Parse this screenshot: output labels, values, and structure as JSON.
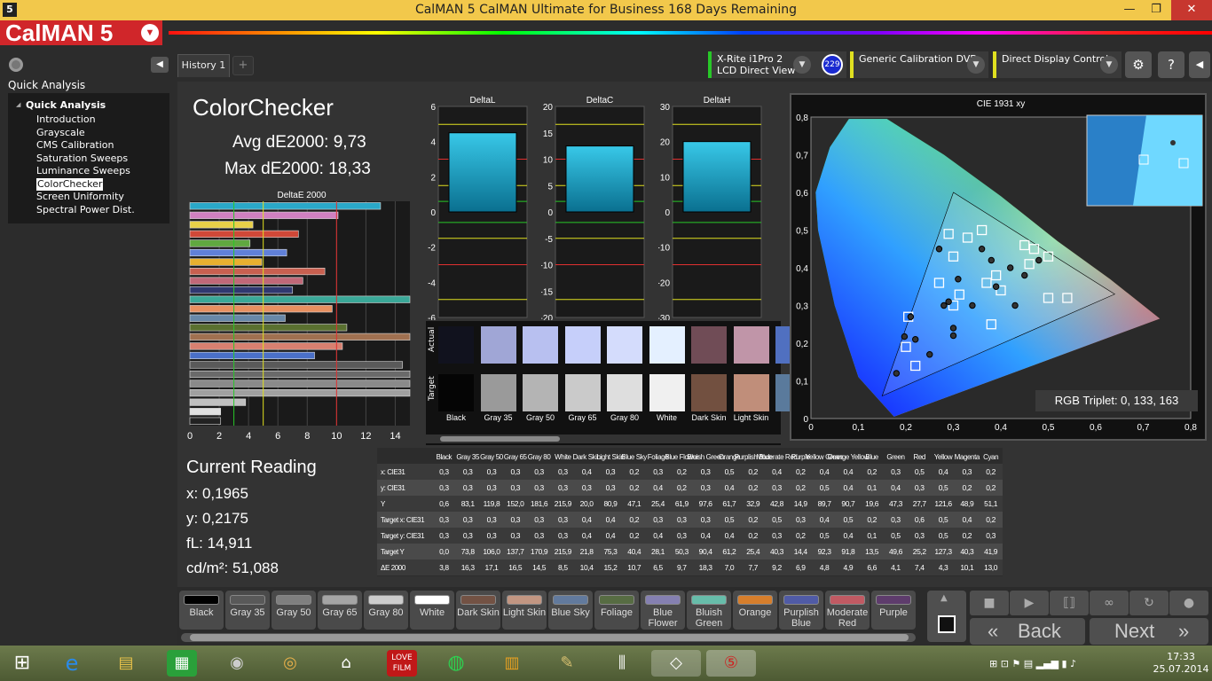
{
  "window": {
    "title": "CalMAN 5 CalMAN Ultimate for Business 168 Days Remaining",
    "app_icon": "5",
    "min": "—",
    "max": "❐",
    "close": "✕"
  },
  "logo": {
    "text": "CalMAN 5"
  },
  "sidebar": {
    "title": "Quick Analysis",
    "group": "Quick Analysis",
    "items": [
      "Introduction",
      "Grayscale",
      "CMS Calibration",
      "Saturation Sweeps",
      "Luminance Sweeps",
      "ColorChecker",
      "Screen Uniformity",
      "Spectral Power Dist."
    ],
    "selected": "ColorChecker"
  },
  "tabs": {
    "history": "History 1",
    "add": "+"
  },
  "devices": [
    {
      "line1": "X-Rite i1Pro 2",
      "line2": "LCD Direct View",
      "badge": "229",
      "color": "#28c828"
    },
    {
      "line1": "Generic Calibration DVD",
      "line2": "",
      "color": "#e0e020"
    },
    {
      "line1": "Direct Display Control",
      "line2": "",
      "color": "#e0e020"
    }
  ],
  "toolbar": {
    "settings": "⚙",
    "help": "?",
    "collapse": "◀"
  },
  "colorchecker": {
    "title": "ColorChecker",
    "avg": "Avg dE2000: 9,73",
    "max": "Max dE2000: 18,33"
  },
  "chart_data": [
    {
      "type": "bar",
      "title": "DeltaE 2000",
      "orientation": "horizontal",
      "xlim": [
        0,
        15
      ],
      "xticks": [
        "0",
        "2",
        "4",
        "6",
        "8",
        "10",
        "12",
        "14"
      ],
      "categories": [
        "Black",
        "Gray 35",
        "Gray 50",
        "Gray 65",
        "Gray 80",
        "White",
        "Dark Skin",
        "Light Skin",
        "Blue Sky",
        "Foliage",
        "Blue Flower",
        "Bluish Green",
        "Orange",
        "Purplish Blue",
        "Moderate Red",
        "Purple",
        "Yellow Green",
        "Orange Yellow",
        "Blue",
        "Green",
        "Red",
        "Yellow",
        "Magenta",
        "Cyan"
      ],
      "values": [
        13.0,
        10.1,
        4.3,
        7.4,
        4.1,
        6.6,
        4.9,
        9.2,
        7.7,
        7.0,
        18.3,
        9.7,
        6.5,
        10.7,
        15.2,
        10.4,
        8.5,
        14.5,
        16.5,
        17.1,
        16.3,
        3.8,
        2.1,
        2.1
      ],
      "reference_lines": [
        3,
        5,
        10
      ]
    },
    {
      "type": "bar",
      "title": "DeltaL",
      "ylim": [
        -6,
        6
      ],
      "yticks": [
        "6",
        "4",
        "2",
        "0",
        "-2",
        "-4",
        "-6"
      ],
      "values": [
        4.5
      ]
    },
    {
      "type": "bar",
      "title": "DeltaC",
      "ylim": [
        -20,
        20
      ],
      "yticks": [
        "20",
        "15",
        "10",
        "5",
        "0",
        "-5",
        "-10",
        "-15",
        "-20"
      ],
      "values": [
        12.5
      ]
    },
    {
      "type": "bar",
      "title": "DeltaH",
      "ylim": [
        -30,
        30
      ],
      "yticks": [
        "30",
        "20",
        "10",
        "0",
        "-10",
        "-20",
        "-30"
      ],
      "values": [
        20
      ]
    },
    {
      "type": "scatter",
      "title": "CIE 1931 xy",
      "xlim": [
        0,
        0.8
      ],
      "ylim": [
        0,
        0.8
      ],
      "xticks": [
        "0",
        "0,1",
        "0,2",
        "0,3",
        "0,4",
        "0,5",
        "0,6",
        "0,7",
        "0,8"
      ],
      "yticks": [
        "0,8",
        "0,7",
        "0,6",
        "0,5",
        "0,4",
        "0,3",
        "0,2",
        "0,1",
        "0"
      ],
      "targets_x": [
        0.3127,
        0.29,
        0.27,
        0.2,
        0.205,
        0.36,
        0.39,
        0.46,
        0.3,
        0.5,
        0.38,
        0.45,
        0.33,
        0.22,
        0.3,
        0.37,
        0.5,
        0.47,
        0.54,
        0.4
      ],
      "targets_y": [
        0.329,
        0.49,
        0.36,
        0.19,
        0.27,
        0.5,
        0.38,
        0.41,
        0.43,
        0.32,
        0.25,
        0.46,
        0.48,
        0.14,
        0.3,
        0.36,
        0.43,
        0.45,
        0.32,
        0.34
      ],
      "actual_x": [
        0.197,
        0.27,
        0.28,
        0.29,
        0.31,
        0.36,
        0.39,
        0.43,
        0.22,
        0.25,
        0.3,
        0.45,
        0.48,
        0.18,
        0.3,
        0.34,
        0.42,
        0.38,
        0.21
      ],
      "actual_y": [
        0.2175,
        0.45,
        0.3,
        0.31,
        0.37,
        0.45,
        0.35,
        0.3,
        0.21,
        0.17,
        0.22,
        0.38,
        0.42,
        0.12,
        0.24,
        0.3,
        0.4,
        0.42,
        0.27
      ]
    }
  ],
  "cie": {
    "readout": "RGB Triplet: 0, 133, 163"
  },
  "swatches": {
    "actual_label": "Actual",
    "target_label": "Target",
    "names": [
      "Black",
      "Gray 35",
      "Gray 50",
      "Gray 65",
      "Gray 80",
      "White",
      "Dark Skin",
      "Light Skin",
      "B"
    ],
    "actual": [
      "#11121e",
      "#a0a6d6",
      "#b8c0f0",
      "#c6cffa",
      "#d4dcfc",
      "#e4f0ff",
      "#704c56",
      "#c095a8",
      "#5070c0"
    ],
    "target": [
      "#050505",
      "#9a9a9a",
      "#b4b4b4",
      "#cacaca",
      "#dedede",
      "#f0f0f0",
      "#725040",
      "#c08e7a",
      "#5a7a9c"
    ]
  },
  "table": {
    "cols": [
      "Black",
      "Gray 35",
      "Gray 50",
      "Gray 65",
      "Gray 80",
      "White",
      "Dark Skin",
      "Light Skin",
      "Blue Sky",
      "Foliage",
      "Blue Flower",
      "Bluish Green",
      "Orange",
      "Purplish Blue",
      "Moderate Red",
      "Purple",
      "Yellow Green",
      "Orange Yellow",
      "Blue",
      "Green",
      "Red",
      "Yellow",
      "Magenta",
      "Cyan"
    ],
    "rows": [
      {
        "label": "x: CIE31",
        "cells": [
          "0,3",
          "0,3",
          "0,3",
          "0,3",
          "0,3",
          "0,3",
          "0,4",
          "0,3",
          "0,2",
          "0,3",
          "0,2",
          "0,3",
          "0,5",
          "0,2",
          "0,4",
          "0,2",
          "0,4",
          "0,4",
          "0,2",
          "0,3",
          "0,5",
          "0,4",
          "0,3",
          "0,2"
        ]
      },
      {
        "label": "y: CIE31",
        "cells": [
          "0,3",
          "0,3",
          "0,3",
          "0,3",
          "0,3",
          "0,3",
          "0,3",
          "0,3",
          "0,2",
          "0,4",
          "0,2",
          "0,3",
          "0,4",
          "0,2",
          "0,3",
          "0,2",
          "0,5",
          "0,4",
          "0,1",
          "0,4",
          "0,3",
          "0,5",
          "0,2",
          "0,2"
        ]
      },
      {
        "label": "Y",
        "cells": [
          "0,6",
          "83,1",
          "119,8",
          "152,0",
          "181,6",
          "215,9",
          "20,0",
          "80,9",
          "47,1",
          "25,4",
          "61,9",
          "97,6",
          "61,7",
          "32,9",
          "42,8",
          "14,9",
          "89,7",
          "90,7",
          "19,6",
          "47,3",
          "27,7",
          "121,6",
          "48,9",
          "51,1"
        ]
      },
      {
        "label": "Target x: CIE31",
        "cells": [
          "0,3",
          "0,3",
          "0,3",
          "0,3",
          "0,3",
          "0,3",
          "0,4",
          "0,4",
          "0,2",
          "0,3",
          "0,3",
          "0,3",
          "0,5",
          "0,2",
          "0,5",
          "0,3",
          "0,4",
          "0,5",
          "0,2",
          "0,3",
          "0,6",
          "0,5",
          "0,4",
          "0,2"
        ]
      },
      {
        "label": "Target y: CIE31",
        "cells": [
          "0,3",
          "0,3",
          "0,3",
          "0,3",
          "0,3",
          "0,3",
          "0,4",
          "0,4",
          "0,2",
          "0,4",
          "0,3",
          "0,4",
          "0,4",
          "0,2",
          "0,3",
          "0,2",
          "0,5",
          "0,4",
          "0,1",
          "0,5",
          "0,3",
          "0,5",
          "0,2",
          "0,3"
        ]
      },
      {
        "label": "Target Y",
        "cells": [
          "0,0",
          "73,8",
          "106,0",
          "137,7",
          "170,9",
          "215,9",
          "21,8",
          "75,3",
          "40,4",
          "28,1",
          "50,3",
          "90,4",
          "61,2",
          "25,4",
          "40,3",
          "14,4",
          "92,3",
          "91,8",
          "13,5",
          "49,6",
          "25,2",
          "127,3",
          "40,3",
          "41,9"
        ]
      },
      {
        "label": "ΔE 2000",
        "cells": [
          "3,8",
          "16,3",
          "17,1",
          "16,5",
          "14,5",
          "8,5",
          "10,4",
          "15,2",
          "10,7",
          "6,5",
          "9,7",
          "18,3",
          "7,0",
          "7,7",
          "9,2",
          "6,9",
          "4,8",
          "4,9",
          "6,6",
          "4,1",
          "7,4",
          "4,3",
          "10,1",
          "13,0"
        ]
      }
    ]
  },
  "current": {
    "title": "Current Reading",
    "x": "x: 0,1965",
    "y": "y: 0,2175",
    "fl": "fL: 14,911",
    "cd": "cd/m²: 51,088"
  },
  "bottom_swatches": [
    {
      "l1": "Black",
      "l2": "",
      "c": "#000000"
    },
    {
      "l1": "Gray 35",
      "l2": "",
      "c": "#595959"
    },
    {
      "l1": "Gray 50",
      "l2": "",
      "c": "#7f7f7f"
    },
    {
      "l1": "Gray 65",
      "l2": "",
      "c": "#a5a5a5"
    },
    {
      "l1": "Gray 80",
      "l2": "",
      "c": "#cccccc"
    },
    {
      "l1": "White",
      "l2": "",
      "c": "#ffffff"
    },
    {
      "l1": "Dark Skin",
      "l2": "",
      "c": "#735244"
    },
    {
      "l1": "Light Skin",
      "l2": "",
      "c": "#c29682"
    },
    {
      "l1": "Blue Sky",
      "l2": "",
      "c": "#627a9d"
    },
    {
      "l1": "Foliage",
      "l2": "",
      "c": "#576c43"
    },
    {
      "l1": "Blue",
      "l2": "Flower",
      "c": "#8580b1"
    },
    {
      "l1": "Bluish",
      "l2": "Green",
      "c": "#67bdaa"
    },
    {
      "l1": "Orange",
      "l2": "",
      "c": "#d67e2c"
    },
    {
      "l1": "Purplish",
      "l2": "Blue",
      "c": "#505ba6"
    },
    {
      "l1": "Moderate",
      "l2": "Red",
      "c": "#c15a63"
    },
    {
      "l1": "Purple",
      "l2": "",
      "c": "#5e3c6c"
    }
  ],
  "player": {
    "back": "Back",
    "next": "Next",
    "back_icon": "«",
    "next_icon": "»"
  },
  "taskbar": {
    "time": "17:33",
    "date": "25.07.2014"
  }
}
